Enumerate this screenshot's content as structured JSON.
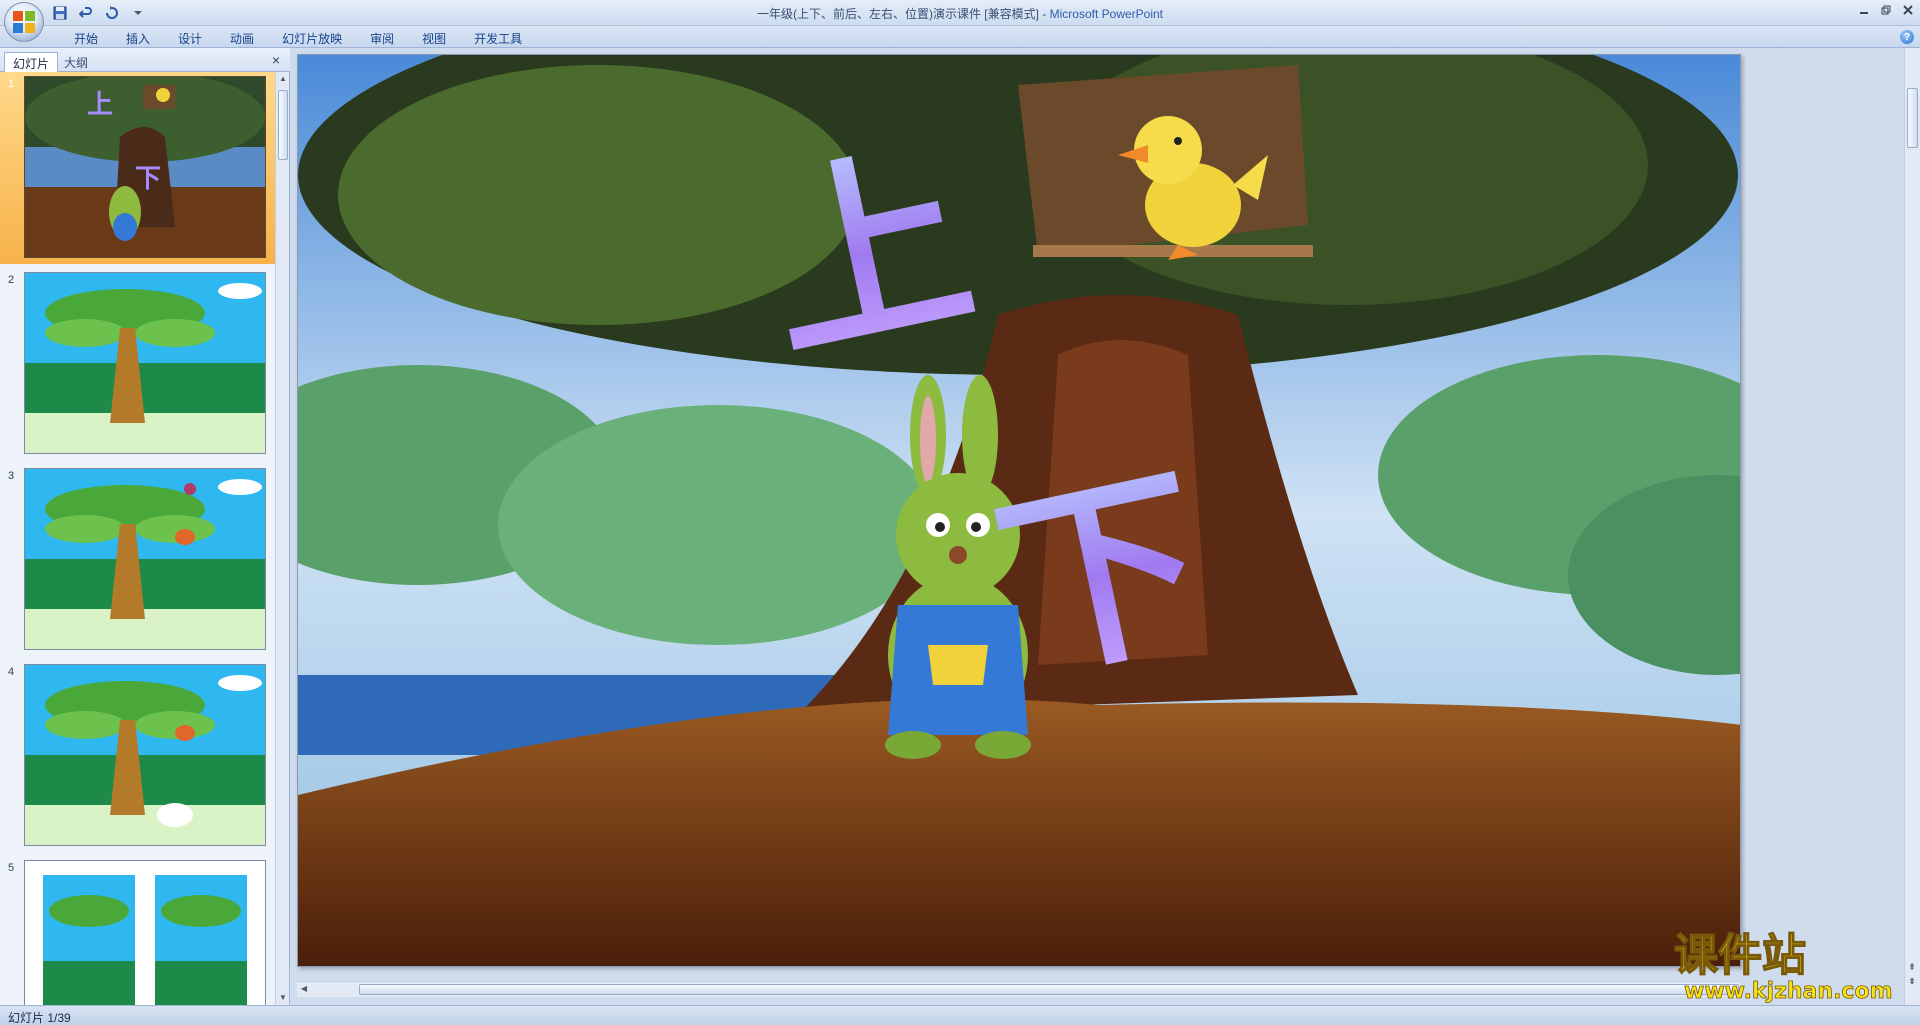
{
  "window": {
    "title": "一年级(上下、前后、左右、位置)演示课件 [兼容模式]",
    "app_name": "Microsoft PowerPoint",
    "title_separator": " - "
  },
  "quick_access": {
    "icons": [
      "save-icon",
      "undo-icon",
      "redo-icon",
      "customize-icon"
    ]
  },
  "ribbon": {
    "tabs": [
      "开始",
      "插入",
      "设计",
      "动画",
      "幻灯片放映",
      "审阅",
      "视图",
      "开发工具"
    ]
  },
  "left_pane": {
    "tab_slides": "幻灯片",
    "tab_outline": "大纲",
    "close_label": "×",
    "thumbnails": [
      {
        "number": "1",
        "selected": true
      },
      {
        "number": "2",
        "selected": false
      },
      {
        "number": "3",
        "selected": false
      },
      {
        "number": "4",
        "selected": false
      },
      {
        "number": "5",
        "selected": false
      }
    ]
  },
  "slide": {
    "char_top": "上",
    "char_bottom": "下"
  },
  "watermark": {
    "cn": "课件站",
    "url": "www.kjzhan.com"
  },
  "status": {
    "slide_position": "幻灯片 1/39"
  },
  "colors": {
    "accent": "#2f5da7",
    "selected_thumb": "#f7b24a",
    "character_fill": "#a78bff"
  }
}
